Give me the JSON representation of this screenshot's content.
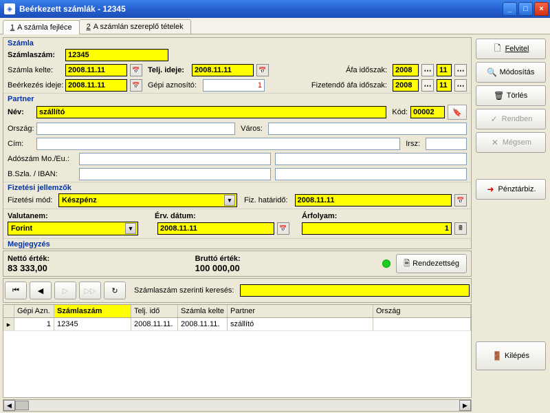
{
  "window": {
    "title": "Beérkezett számlák - 12345"
  },
  "tabs": [
    {
      "num": "1",
      "label": "A számla fejléce"
    },
    {
      "num": "2",
      "label": "A számlán szereplő tételek"
    }
  ],
  "sidebar": {
    "felvitel": "Felvitel",
    "modositas": "Módosítás",
    "torles": "Törlés",
    "rendben": "Rendben",
    "megsem": "Mégsem",
    "penztarbiz": "Pénztárbiz.",
    "kilepes": "Kilépés"
  },
  "szamla": {
    "section": "Számla",
    "szamlaszam_lbl": "Számlaszám:",
    "szamlaszam": "12345",
    "kelte_lbl": "Számla kelte:",
    "kelte": "2008.11.11",
    "telj_lbl": "Telj. ideje:",
    "telj": "2008.11.11",
    "afa_lbl": "Áfa időszak:",
    "afa_ev": "2008",
    "afa_ho": "11",
    "beerk_lbl": "Beérkezés ideje:",
    "beerk": "2008.11.11",
    "gepi_lbl": "Gépi aznosító:",
    "gepi": "1",
    "fizafa_lbl": "Fizetendő áfa időszak:",
    "fizafa_ev": "2008",
    "fizafa_ho": "11"
  },
  "partner": {
    "section": "Partner",
    "nev_lbl": "Név:",
    "nev": "szállító",
    "kod_lbl": "Kód:",
    "kod": "00002",
    "orszag_lbl": "Ország:",
    "varos_lbl": "Város:",
    "cim_lbl": "Cím:",
    "irsz_lbl": "Irsz:",
    "adoszam_lbl": "Adószám Mo./Eu.:",
    "iban_lbl": "B.Szla. / IBAN:"
  },
  "fizetes": {
    "section": "Fizetési jellemzők",
    "mod_lbl": "Fizetési mód:",
    "mod": "Készpénz",
    "hatar_lbl": "Fiz. határidő:",
    "hatar": "2008.11.11"
  },
  "valuta": {
    "nem_lbl": "Valutanem:",
    "nem": "Forint",
    "erv_lbl": "Érv. dátum:",
    "erv": "2008.11.11",
    "arf_lbl": "Árfolyam:",
    "arf": "1"
  },
  "megj": {
    "section": "Megjegyzés"
  },
  "totals": {
    "netto_lbl": "Nettó érték:",
    "netto": "83 333,00",
    "brutto_lbl": "Bruttó érték:",
    "brutto": "100 000,00",
    "rendez": "Rendezettség"
  },
  "search": {
    "label": "Számlaszám szerinti keresés:"
  },
  "grid": {
    "headers": [
      "Gépi Azn.",
      "Számlaszám",
      "Telj. idő",
      "Számla kelte",
      "Partner",
      "Ország"
    ],
    "row": {
      "gepi": "1",
      "szamla": "12345",
      "telj": "2008.11.11.",
      "kelte": "2008.11.11.",
      "partner": "szállító",
      "orszag": ""
    }
  }
}
